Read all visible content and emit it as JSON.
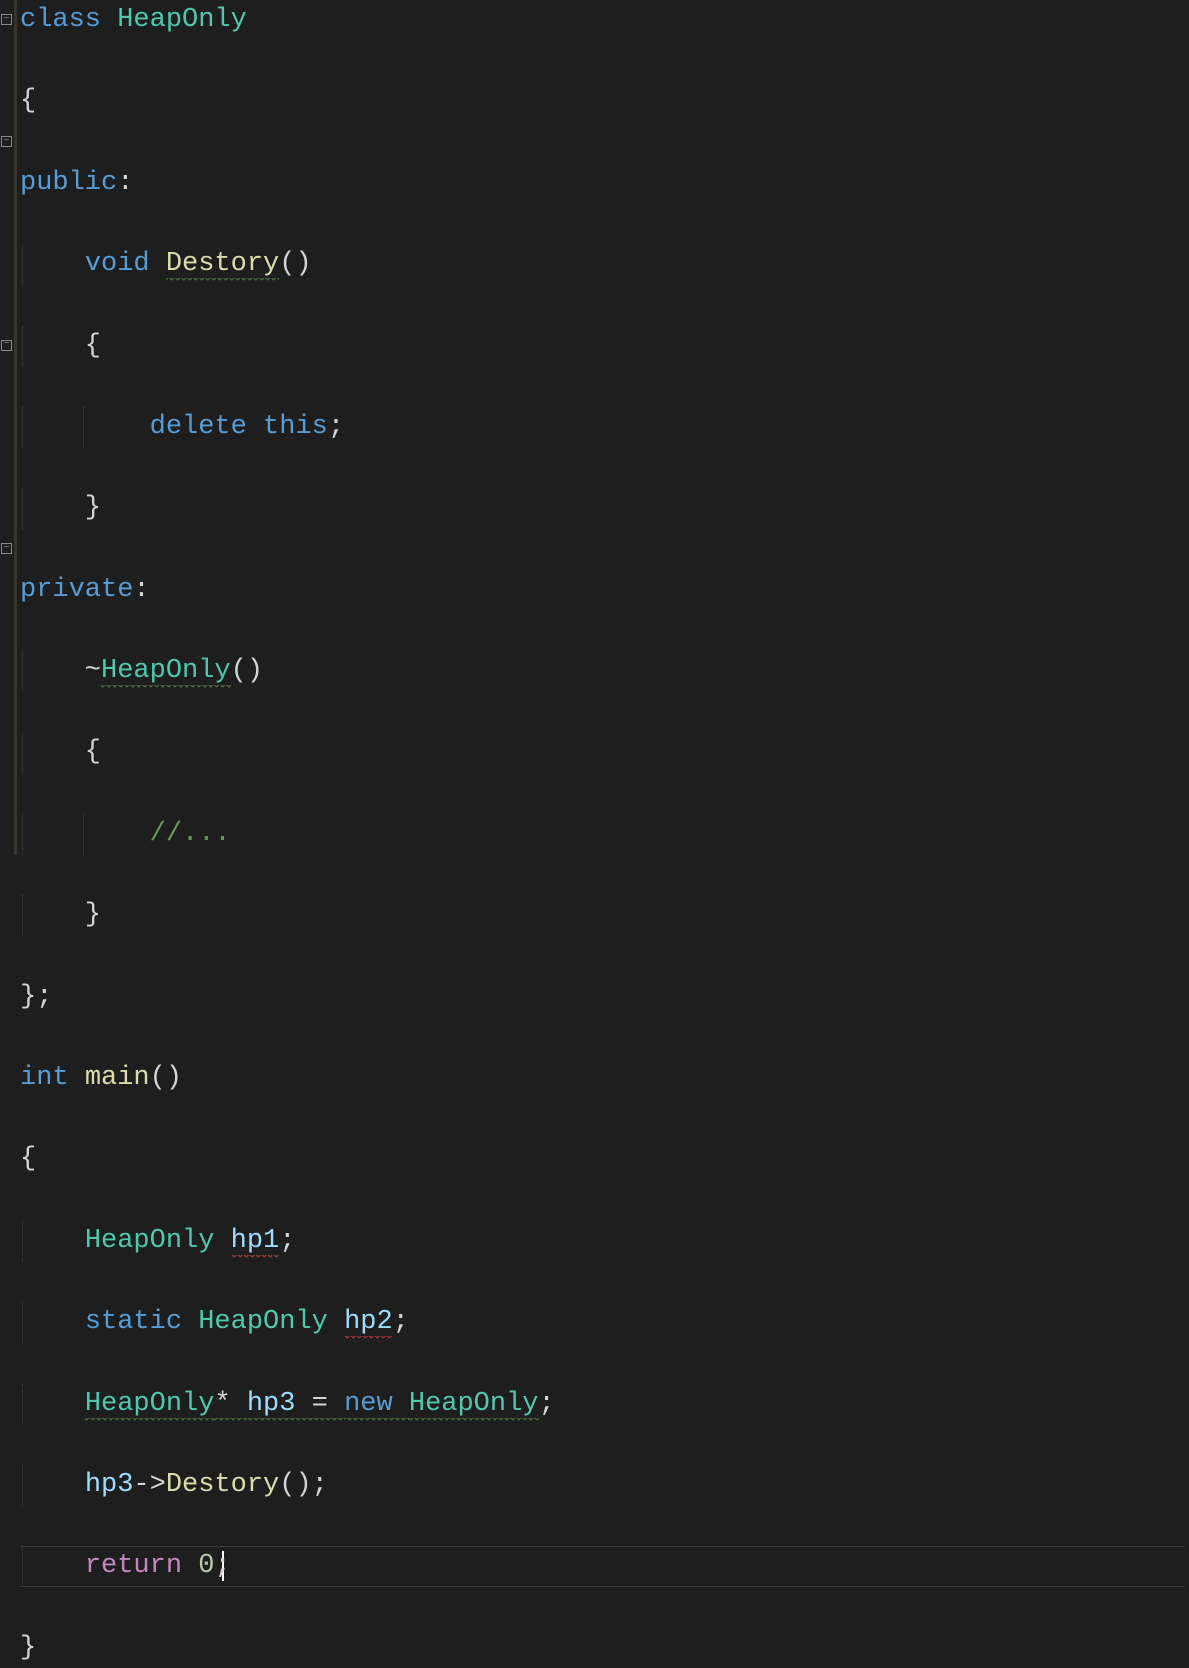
{
  "code": {
    "lines": [
      {
        "tokens": [
          {
            "t": "class ",
            "c": "kw-class"
          },
          {
            "t": "HeapOnly",
            "c": "type-name"
          }
        ],
        "fold": "minus"
      },
      {
        "tokens": [
          {
            "t": "{",
            "c": "brace"
          }
        ]
      },
      {
        "tokens": [
          {
            "t": "public",
            "c": "kw-access"
          },
          {
            "t": ":",
            "c": "plain"
          }
        ]
      },
      {
        "tokens": [
          {
            "t": "    ",
            "c": ""
          },
          {
            "t": "void ",
            "c": "kw-void"
          },
          {
            "t": "Destory",
            "c": "func-name",
            "squiggle": "green"
          },
          {
            "t": "()",
            "c": "paren"
          }
        ],
        "fold": "minus"
      },
      {
        "tokens": [
          {
            "t": "    {",
            "c": "brace"
          }
        ]
      },
      {
        "tokens": [
          {
            "t": "        ",
            "c": ""
          },
          {
            "t": "delete ",
            "c": "kw-delete"
          },
          {
            "t": "this",
            "c": "kw-this"
          },
          {
            "t": ";",
            "c": "semi"
          }
        ]
      },
      {
        "tokens": [
          {
            "t": "    }",
            "c": "brace"
          }
        ]
      },
      {
        "tokens": [
          {
            "t": "private",
            "c": "kw-access"
          },
          {
            "t": ":",
            "c": "plain"
          }
        ]
      },
      {
        "tokens": [
          {
            "t": "    ~",
            "c": "tilde"
          },
          {
            "t": "HeapOnly",
            "c": "type-name",
            "squiggle": "green"
          },
          {
            "t": "()",
            "c": "paren"
          }
        ],
        "fold": "minus"
      },
      {
        "tokens": [
          {
            "t": "    {",
            "c": "brace"
          }
        ]
      },
      {
        "tokens": [
          {
            "t": "        ",
            "c": ""
          },
          {
            "t": "//...",
            "c": "comment"
          }
        ]
      },
      {
        "tokens": [
          {
            "t": "    }",
            "c": "brace"
          }
        ]
      },
      {
        "tokens": [
          {
            "t": "};",
            "c": "brace"
          }
        ]
      },
      {
        "tokens": [
          {
            "t": "int ",
            "c": "kw-int"
          },
          {
            "t": "main",
            "c": "func-name"
          },
          {
            "t": "()",
            "c": "paren"
          }
        ],
        "fold": "minus"
      },
      {
        "tokens": [
          {
            "t": "{",
            "c": "brace"
          }
        ]
      },
      {
        "tokens": [
          {
            "t": "    ",
            "c": ""
          },
          {
            "t": "HeapOnly ",
            "c": "type-name"
          },
          {
            "t": "hp1",
            "c": "var-name",
            "squiggle": "red"
          },
          {
            "t": ";",
            "c": "semi"
          }
        ]
      },
      {
        "tokens": [
          {
            "t": "    ",
            "c": ""
          },
          {
            "t": "static ",
            "c": "kw-static"
          },
          {
            "t": "HeapOnly ",
            "c": "type-name"
          },
          {
            "t": "hp2",
            "c": "var-name",
            "squiggle": "red"
          },
          {
            "t": ";",
            "c": "semi"
          }
        ]
      },
      {
        "tokens": [
          {
            "t": "    ",
            "c": ""
          },
          {
            "t": "HeapOnly",
            "c": "type-name",
            "squiggle": "green"
          },
          {
            "t": "* ",
            "c": "op",
            "squiggle": "green"
          },
          {
            "t": "hp3",
            "c": "var-name",
            "squiggle": "green"
          },
          {
            "t": " = ",
            "c": "op",
            "squiggle": "green"
          },
          {
            "t": "new ",
            "c": "kw-new",
            "squiggle": "green"
          },
          {
            "t": "HeapOnly",
            "c": "type-name",
            "squiggle": "green"
          },
          {
            "t": ";",
            "c": "semi"
          }
        ]
      },
      {
        "tokens": [
          {
            "t": "    ",
            "c": ""
          },
          {
            "t": "hp3",
            "c": "var-name"
          },
          {
            "t": "->",
            "c": "op"
          },
          {
            "t": "Destory",
            "c": "member-access"
          },
          {
            "t": "();",
            "c": "paren"
          }
        ]
      },
      {
        "tokens": [
          {
            "t": "    ",
            "c": ""
          },
          {
            "t": "return ",
            "c": "kw-return"
          },
          {
            "t": "0",
            "c": "num"
          },
          {
            "t": ";",
            "c": "semi"
          }
        ],
        "current": true,
        "cursorCol": 13
      },
      {
        "tokens": [
          {
            "t": "}",
            "c": "brace"
          }
        ]
      }
    ]
  },
  "fold": {
    "minus_glyph": "−"
  }
}
